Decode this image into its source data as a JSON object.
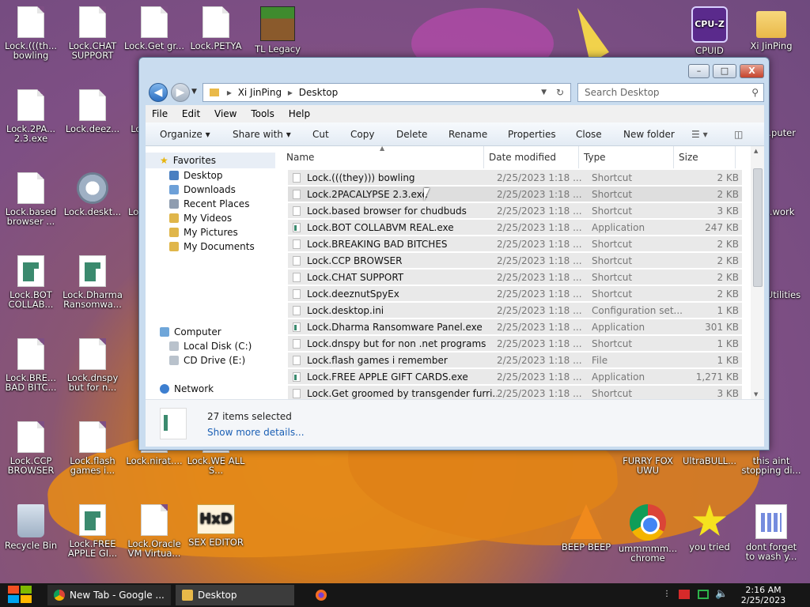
{
  "desktop": {
    "icons_left": [
      {
        "label": "Lock.(((th... bowling",
        "type": "doc"
      },
      {
        "label": "Lock.CHAT SUPPORT",
        "type": "doc"
      },
      {
        "label": "Lock.Get gr...",
        "type": "doc"
      },
      {
        "label": "Lock.PETYA",
        "type": "doc"
      },
      {
        "label": "TL Legacy",
        "type": "minecraft"
      },
      {
        "label": "Lock.2PA... 2.3.exe",
        "type": "doc"
      },
      {
        "label": "Lock.deez...",
        "type": "doc"
      },
      {
        "label": "Lock. FU...",
        "type": "doc"
      },
      {
        "label": "Lock.based browser ...",
        "type": "doc"
      },
      {
        "label": "Lock.deskt...",
        "type": "gear"
      },
      {
        "label": "Lock. pho...",
        "type": "doc"
      },
      {
        "label": "Lock.BOT COLLAB...",
        "type": "app"
      },
      {
        "label": "Lock.Dharma Ransomwa...",
        "type": "app"
      },
      {
        "label": "Lo...",
        "type": "doc"
      },
      {
        "label": "Lock.BRE... BAD BITC...",
        "type": "doc"
      },
      {
        "label": "Lock.dnspy but for n...",
        "type": "doc"
      },
      {
        "label": "Lo...",
        "type": "doc"
      },
      {
        "label": "Lock.CCP BROWSER",
        "type": "doc"
      },
      {
        "label": "Lock.flash games i...",
        "type": "doc"
      },
      {
        "label": "Lock.nirat....",
        "type": "doc"
      },
      {
        "label": "Lock.WE ALL S...",
        "type": "doc"
      },
      {
        "label": "Recycle Bin",
        "type": "bin"
      },
      {
        "label": "Lock.FREE APPLE GI...",
        "type": "app"
      },
      {
        "label": "Lock.Oracle VM Virtua...",
        "type": "doc"
      },
      {
        "label": "SEX EDITOR",
        "type": "hxd"
      }
    ],
    "icons_right": [
      {
        "label": "CPUID",
        "type": "cpuz"
      },
      {
        "label": "Xi JinPing",
        "type": "folder"
      },
      {
        "label": "...puter",
        "type": "other"
      },
      {
        "label": "...work",
        "type": "other"
      },
      {
        "label": "...Utilities",
        "type": "other"
      },
      {
        "label": "FURRY FOX UWU",
        "type": "other"
      },
      {
        "label": "UltraBULL...",
        "type": "other"
      },
      {
        "label": "this aint stopping di...",
        "type": "other"
      },
      {
        "label": "BEEP BEEP",
        "type": "cone"
      },
      {
        "label": "ummmmm... chrome",
        "type": "chrome"
      },
      {
        "label": "you tried",
        "type": "star"
      },
      {
        "label": "dont forget to wash y...",
        "type": "cal"
      }
    ]
  },
  "explorer": {
    "window_buttons": {
      "minimize": "–",
      "maximize": "□",
      "close": "X"
    },
    "breadcrumb": [
      "Xi JinPing",
      "Desktop"
    ],
    "search_placeholder": "Search Desktop",
    "menu": [
      "File",
      "Edit",
      "View",
      "Tools",
      "Help"
    ],
    "toolbar": [
      "Organize ▾",
      "Share with ▾",
      "Cut",
      "Copy",
      "Delete",
      "Rename",
      "Properties",
      "Close",
      "New folder"
    ],
    "nav": {
      "favorites": "Favorites",
      "favorites_items": [
        "Desktop",
        "Downloads",
        "Recent Places",
        "My Videos",
        "My Pictures",
        "My Documents"
      ],
      "computer": "Computer",
      "computer_items": [
        "Local Disk (C:)",
        "CD Drive (E:)"
      ],
      "network": "Network"
    },
    "columns": [
      "Name",
      "Date modified",
      "Type",
      "Size"
    ],
    "rows": [
      {
        "name": "Lock.(((they))) bowling",
        "date": "2/25/2023 1:18 ...",
        "type": "Shortcut",
        "size": "2 KB",
        "icon": "doc"
      },
      {
        "name": "Lock.2PACALYPSE 2.3.exe",
        "date": "2/25/2023 1:18 ...",
        "type": "Shortcut",
        "size": "2 KB",
        "icon": "doc"
      },
      {
        "name": "Lock.based browser for chudbuds",
        "date": "2/25/2023 1:18 ...",
        "type": "Shortcut",
        "size": "3 KB",
        "icon": "doc"
      },
      {
        "name": "Lock.BOT COLLABVM REAL.exe",
        "date": "2/25/2023 1:18 ...",
        "type": "Application",
        "size": "247 KB",
        "icon": "app"
      },
      {
        "name": "Lock.BREAKING BAD BITCHES",
        "date": "2/25/2023 1:18 ...",
        "type": "Shortcut",
        "size": "2 KB",
        "icon": "doc"
      },
      {
        "name": "Lock.CCP BROWSER",
        "date": "2/25/2023 1:18 ...",
        "type": "Shortcut",
        "size": "2 KB",
        "icon": "doc"
      },
      {
        "name": "Lock.CHAT SUPPORT",
        "date": "2/25/2023 1:18 ...",
        "type": "Shortcut",
        "size": "2 KB",
        "icon": "doc"
      },
      {
        "name": "Lock.deeznutSpyEx",
        "date": "2/25/2023 1:18 ...",
        "type": "Shortcut",
        "size": "2 KB",
        "icon": "doc"
      },
      {
        "name": "Lock.desktop.ini",
        "date": "2/25/2023 1:18 ...",
        "type": "Configuration set...",
        "size": "1 KB",
        "icon": "ini"
      },
      {
        "name": "Lock.Dharma Ransomware Panel.exe",
        "date": "2/25/2023 1:18 ...",
        "type": "Application",
        "size": "301 KB",
        "icon": "app"
      },
      {
        "name": "Lock.dnspy but for non .net programs",
        "date": "2/25/2023 1:18 ...",
        "type": "Shortcut",
        "size": "1 KB",
        "icon": "doc"
      },
      {
        "name": "Lock.flash games i remember",
        "date": "2/25/2023 1:18 ...",
        "type": "File",
        "size": "1 KB",
        "icon": "doc"
      },
      {
        "name": "Lock.FREE APPLE GIFT CARDS.exe",
        "date": "2/25/2023 1:18 ...",
        "type": "Application",
        "size": "1,271 KB",
        "icon": "app"
      },
      {
        "name": "Lock.Get groomed by transgender furri...",
        "date": "2/25/2023 1:18 ...",
        "type": "Shortcut",
        "size": "3 KB",
        "icon": "doc"
      }
    ],
    "details": {
      "selected": "27 items selected",
      "more": "Show more details..."
    }
  },
  "taskbar": {
    "items": [
      {
        "label": "New Tab - Google ...",
        "icon": "chrome-icon"
      },
      {
        "label": "Desktop",
        "icon": "folder-icon"
      }
    ],
    "clock_time": "2:16 AM",
    "clock_date": "2/25/2023"
  }
}
